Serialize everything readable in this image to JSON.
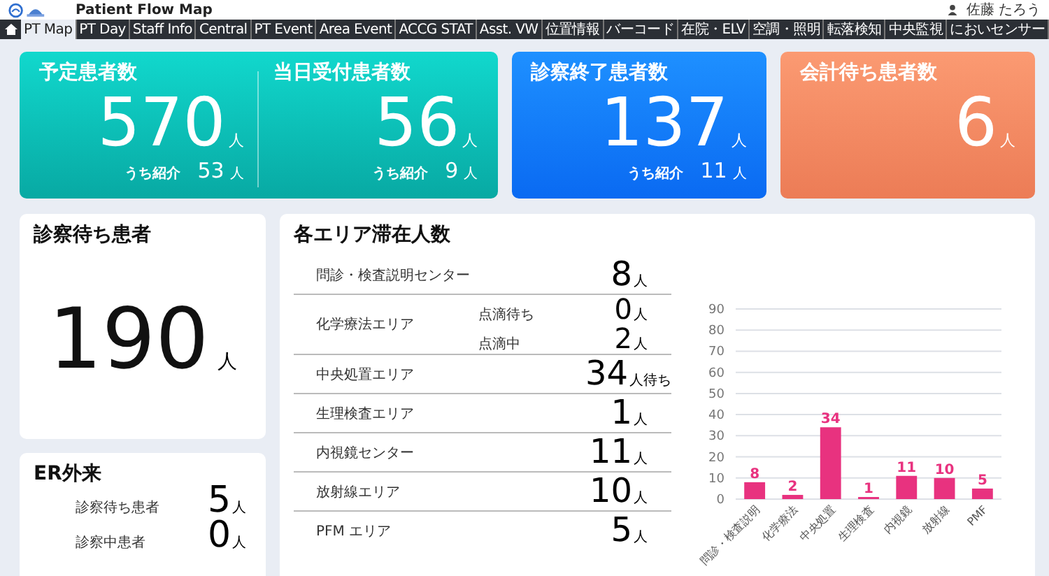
{
  "header": {
    "title": "Patient Flow Map",
    "user": "佐藤 たろう"
  },
  "nav": [
    {
      "label": "PT Map",
      "selected": true
    },
    {
      "label": "PT Day",
      "selected": false
    },
    {
      "label": "Staff Info",
      "selected": false
    },
    {
      "label": "Central",
      "selected": false
    },
    {
      "label": "PT Event",
      "selected": false
    },
    {
      "label": "Area Event",
      "selected": false
    },
    {
      "label": "ACCG STAT",
      "selected": false
    },
    {
      "label": "Asst. VW",
      "selected": false
    },
    {
      "label": "位置情報",
      "selected": false
    },
    {
      "label": "バーコード",
      "selected": false
    },
    {
      "label": "在院・ELV",
      "selected": false
    },
    {
      "label": "空調・照明",
      "selected": false
    },
    {
      "label": "転落検知",
      "selected": false
    },
    {
      "label": "中央監視",
      "selected": false
    },
    {
      "label": "においセンサー",
      "selected": false
    }
  ],
  "top_cards": [
    {
      "sections": [
        {
          "title": "予定患者数",
          "value": "570",
          "unit": "人",
          "sub_label": "うち紹介",
          "sub_value": "53",
          "sub_unit": "人"
        },
        {
          "title": "当日受付患者数",
          "value": "56",
          "unit": "人",
          "sub_label": "うち紹介",
          "sub_value": "9",
          "sub_unit": "人"
        }
      ]
    },
    {
      "sections": [
        {
          "title": "診察終了患者数",
          "value": "137",
          "unit": "人",
          "sub_label": "うち紹介",
          "sub_value": "11",
          "sub_unit": "人"
        }
      ]
    },
    {
      "sections": [
        {
          "title": "会計待ち患者数",
          "value": "6",
          "unit": "人"
        }
      ]
    }
  ],
  "waiting": {
    "title": "診察待ち患者",
    "value": "190",
    "unit": "人"
  },
  "er": {
    "title": "ER外来",
    "rows": [
      {
        "label": "診察待ち患者",
        "value": "5",
        "unit": "人"
      },
      {
        "label": "診察中患者",
        "value": "0",
        "unit": "人"
      }
    ]
  },
  "areas": {
    "title": "各エリア滞在人数",
    "rows": [
      {
        "name": "問診・検査説明センター",
        "counts": [
          {
            "value": "8",
            "unit": "人"
          }
        ]
      },
      {
        "name": "化学療法エリア",
        "counts": [
          {
            "label": "点滴待ち",
            "value": "0",
            "unit": "人"
          },
          {
            "label": "点滴中",
            "value": "2",
            "unit": "人"
          }
        ]
      },
      {
        "name": "中央処置エリア",
        "counts": [
          {
            "value": "34",
            "unit": "人待ち"
          }
        ]
      },
      {
        "name": "生理検査エリア",
        "counts": [
          {
            "value": "1",
            "unit": "人"
          }
        ]
      },
      {
        "name": "内視鏡センター",
        "counts": [
          {
            "value": "11",
            "unit": "人"
          }
        ]
      },
      {
        "name": "放射線エリア",
        "counts": [
          {
            "value": "10",
            "unit": "人"
          }
        ]
      },
      {
        "name": "PFM エリア",
        "counts": [
          {
            "value": "5",
            "unit": "人"
          }
        ]
      }
    ],
    "chart_data": {
      "type": "bar",
      "categories": [
        "問診・検査説明",
        "化学療法",
        "中央処置",
        "生理検査",
        "内視鏡",
        "放射線",
        "PMF"
      ],
      "series": [
        {
          "color": "#e8327f",
          "values": [
            8,
            2,
            34,
            1,
            11,
            10,
            5
          ]
        }
      ],
      "grid": true,
      "ylim": [
        0,
        90
      ],
      "yticks": [
        0,
        10,
        20,
        30,
        40,
        50,
        60,
        70,
        80,
        90
      ],
      "data_labels": true
    }
  }
}
